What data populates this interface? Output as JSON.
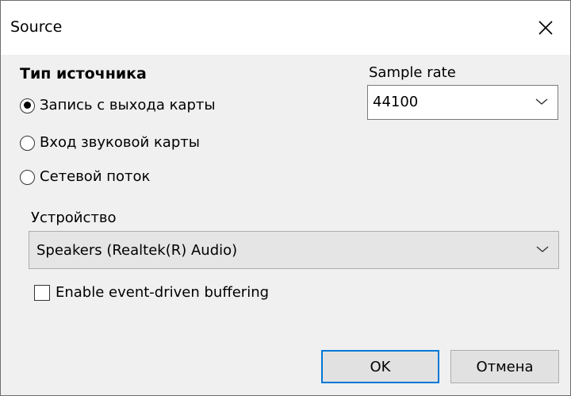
{
  "window": {
    "title": "Source"
  },
  "source_type": {
    "title": "Тип источника",
    "options": [
      {
        "label": "Запись с выхода карты",
        "checked": true
      },
      {
        "label": "Вход звуковой карты",
        "checked": false
      },
      {
        "label": "Сетевой поток",
        "checked": false
      }
    ]
  },
  "sample_rate": {
    "label": "Sample rate",
    "value": "44100"
  },
  "device": {
    "label": "Устройство",
    "value": "Speakers (Realtek(R) Audio)"
  },
  "buffering": {
    "label": "Enable event-driven buffering",
    "checked": false
  },
  "buttons": {
    "ok": "OK",
    "cancel": "Отмена"
  },
  "colors": {
    "accent": "#0078d7",
    "dialog_bg": "#f0f0f0",
    "titlebar_bg": "#ffffff"
  },
  "icons": {
    "close": "close-icon",
    "dropdown": "chevron-down-icon"
  }
}
